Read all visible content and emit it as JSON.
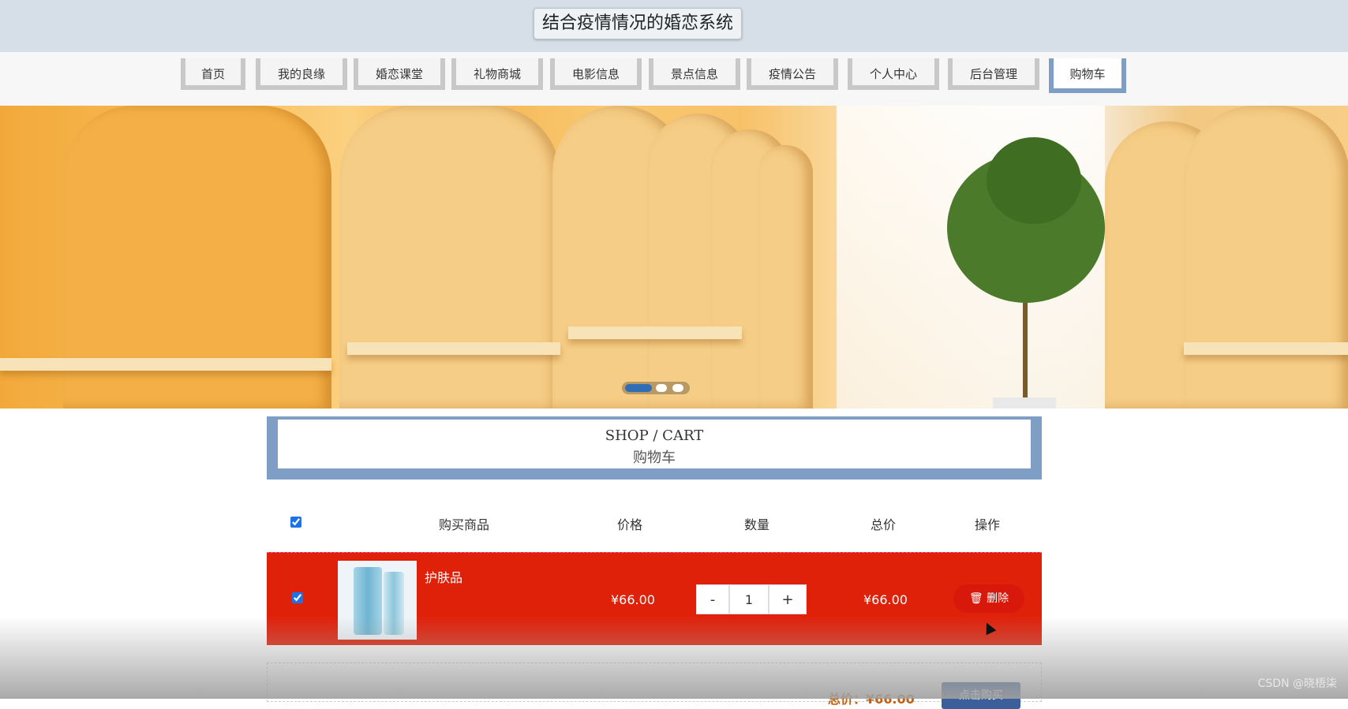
{
  "header": {
    "title": "结合疫情情况的婚恋系统"
  },
  "nav": {
    "items": [
      {
        "label": "首页"
      },
      {
        "label": "我的良缘"
      },
      {
        "label": "婚恋课堂"
      },
      {
        "label": "礼物商城"
      },
      {
        "label": "电影信息"
      },
      {
        "label": "景点信息"
      },
      {
        "label": "疫情公告"
      },
      {
        "label": "个人中心"
      },
      {
        "label": "后台管理"
      },
      {
        "label": "购物车"
      }
    ],
    "active": "购物车"
  },
  "carousel": {
    "slide_count": 3,
    "active_slide": 1
  },
  "section": {
    "title_en": "SHOP / CART",
    "title_zh": "购物车"
  },
  "cart": {
    "columns": [
      "购买商品",
      "价格",
      "数量",
      "总价",
      "操作"
    ],
    "select_all_checked": true,
    "items": [
      {
        "name": "护肤品",
        "price": "¥66.00",
        "quantity": "1",
        "total": "¥66.00",
        "checked": true,
        "minus_label": "-",
        "plus_label": "+",
        "delete_label": "删除"
      }
    ],
    "summary_total": "总价：¥66.00",
    "buy_label": "点击购买"
  },
  "colors": {
    "accent": "#7f9ec6",
    "row_highlight": "#e0210a",
    "buy_button": "#3a5f9a"
  },
  "watermark": "CSDN @晓梧柒"
}
